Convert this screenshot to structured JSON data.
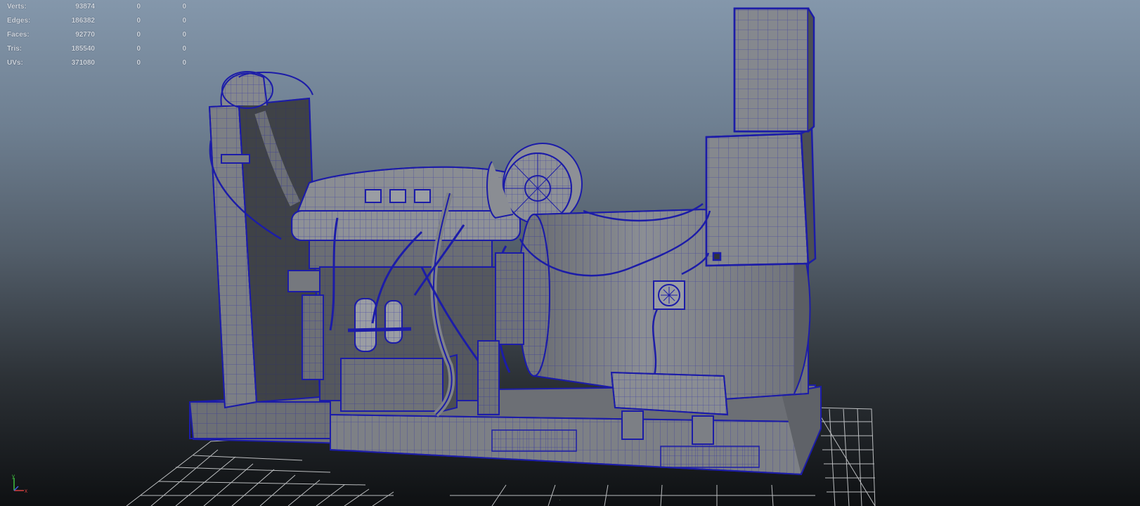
{
  "hud": {
    "rows": [
      {
        "label": "Verts:",
        "v1": "93874",
        "v2": "0",
        "v3": "0"
      },
      {
        "label": "Edges:",
        "v1": "186382",
        "v2": "0",
        "v3": "0"
      },
      {
        "label": "Faces:",
        "v1": "92770",
        "v2": "0",
        "v3": "0"
      },
      {
        "label": "Tris:",
        "v1": "185540",
        "v2": "0",
        "v3": "0"
      },
      {
        "label": "UVs:",
        "v1": "371080",
        "v2": "0",
        "v3": "0"
      }
    ]
  },
  "axis": {
    "y_label": "y",
    "x_label": "x"
  },
  "colors": {
    "wire": "#1c1ca8",
    "surface": "#7a7d83",
    "surface_dark": "#4c4f54",
    "surface_light": "#8d9096",
    "grid": "#d8dadc"
  }
}
